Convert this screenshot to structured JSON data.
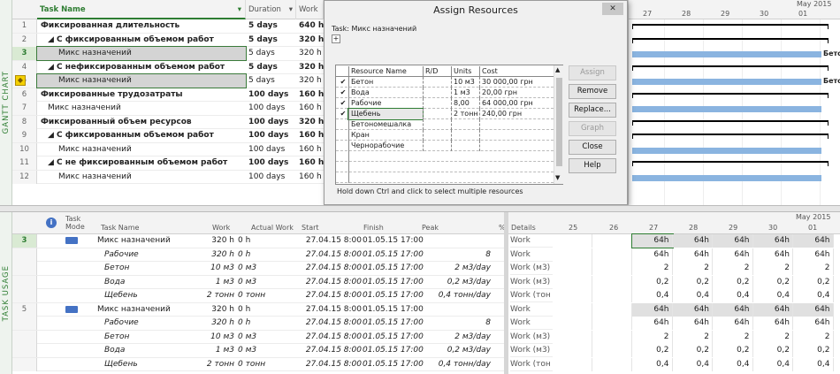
{
  "gantt": {
    "side_label": "GANTT CHART",
    "headers": {
      "task_name": "Task Name",
      "duration": "Duration",
      "work": "Work"
    },
    "rows": [
      {
        "n": "1",
        "name": "Фиксированная длительность",
        "duration": "5 days",
        "work": "640 h",
        "bold": true,
        "indent": 0
      },
      {
        "n": "2",
        "name": "◢ С фиксированным объемом работ",
        "duration": "5 days",
        "work": "320 h",
        "bold": true,
        "indent": 1
      },
      {
        "n": "3",
        "name": "Микс назначений",
        "duration": "5 days",
        "work": "320 h",
        "bold": false,
        "indent": 2
      },
      {
        "n": "4",
        "name": "◢ С нефиксированным объемом работ",
        "duration": "5 days",
        "work": "320 h",
        "bold": true,
        "indent": 1
      },
      {
        "n": "5",
        "name": "Микс назначений",
        "duration": "5 days",
        "work": "320 h",
        "bold": false,
        "indent": 2
      },
      {
        "n": "6",
        "name": "Фиксированные трудозатраты",
        "duration": "100 days",
        "work": "160 h",
        "bold": true,
        "indent": 0
      },
      {
        "n": "7",
        "name": "Микс назначений",
        "duration": "100 days",
        "work": "160 h",
        "bold": false,
        "indent": 1
      },
      {
        "n": "8",
        "name": "Фиксированный объем ресурсов",
        "duration": "100 days",
        "work": "320 h",
        "bold": true,
        "indent": 0
      },
      {
        "n": "9",
        "name": "◢ С фиксированным объемом работ",
        "duration": "100 days",
        "work": "160 h",
        "bold": true,
        "indent": 1
      },
      {
        "n": "10",
        "name": "Микс назначений",
        "duration": "100 days",
        "work": "160 h",
        "bold": false,
        "indent": 2
      },
      {
        "n": "11",
        "name": "◢ С не фиксированным объемом работ",
        "duration": "100 days",
        "work": "160 h",
        "bold": true,
        "indent": 1
      },
      {
        "n": "12",
        "name": "Микс назначений",
        "duration": "100 days",
        "work": "160 h",
        "bold": false,
        "indent": 2
      }
    ],
    "timescale": {
      "month": "May 2015",
      "days": [
        "27",
        "28",
        "29",
        "30",
        "01"
      ]
    },
    "bar_labels": {
      "row3": "Бетон",
      "row5": "Бето"
    }
  },
  "dialog": {
    "title": "Assign Resources",
    "task_label": "Task: Микс назначений",
    "expand": "+",
    "headers": {
      "name": "Resource Name",
      "rd": "R/D",
      "units": "Units",
      "cost": "Cost"
    },
    "resources": [
      {
        "check": "✔",
        "name": "Бетон",
        "units": "10 м3",
        "cost": "30 000,00 грн"
      },
      {
        "check": "✔",
        "name": "Вода",
        "units": "1 м3",
        "cost": "20,00 грн"
      },
      {
        "check": "✔",
        "name": "Рабочие",
        "units": "8,00",
        "cost": "64 000,00 грн"
      },
      {
        "check": "✔",
        "name": "Щебень",
        "units": "2 тонн",
        "cost": "240,00 грн"
      },
      {
        "check": "",
        "name": "Бетономешалка",
        "units": "",
        "cost": ""
      },
      {
        "check": "",
        "name": "Кран",
        "units": "",
        "cost": ""
      },
      {
        "check": "",
        "name": "Чернорабочие",
        "units": "",
        "cost": ""
      }
    ],
    "buttons": {
      "assign": "Assign",
      "remove": "Remove",
      "replace": "Replace...",
      "graph": "Graph",
      "close": "Close",
      "help": "Help"
    },
    "hint": "Hold down Ctrl and click to select multiple resources",
    "close_x": "✕"
  },
  "usage": {
    "side_label": "TASK USAGE",
    "headers": {
      "info": "i",
      "mode": "Task Mode",
      "task_name": "Task Name",
      "work": "Work",
      "actual_work": "Actual Work",
      "start": "Start",
      "finish": "Finish",
      "peak": "Peak",
      "pct": "%"
    },
    "rows": [
      {
        "n": "3",
        "task": true,
        "name": "Микс назначений",
        "work": "320 h",
        "actual": "0 h",
        "start": "27.04.15 8:00",
        "finish": "01.05.15 17:00",
        "peak": ""
      },
      {
        "n": "",
        "task": false,
        "name": "Рабочие",
        "work": "320 h",
        "actual": "0 h",
        "start": "27.04.15 8:00",
        "finish": "01.05.15 17:00",
        "peak": "8"
      },
      {
        "n": "",
        "task": false,
        "name": "Бетон",
        "work": "10 м3",
        "actual": "0 м3",
        "start": "27.04.15 8:00",
        "finish": "01.05.15 17:00",
        "peak": "2 м3/day"
      },
      {
        "n": "",
        "task": false,
        "name": "Вода",
        "work": "1 м3",
        "actual": "0 м3",
        "start": "27.04.15 8:00",
        "finish": "01.05.15 17:00",
        "peak": "0,2 м3/day"
      },
      {
        "n": "",
        "task": false,
        "name": "Щебень",
        "work": "2 тонн",
        "actual": "0 тонн",
        "start": "27.04.15 8:00",
        "finish": "01.05.15 17:00",
        "peak": "0,4 тонн/day"
      },
      {
        "n": "5",
        "task": true,
        "name": "Микс назначений",
        "work": "320 h",
        "actual": "0 h",
        "start": "27.04.15 8:00",
        "finish": "01.05.15 17:00",
        "peak": ""
      },
      {
        "n": "",
        "task": false,
        "name": "Рабочие",
        "work": "320 h",
        "actual": "0 h",
        "start": "27.04.15 8:00",
        "finish": "01.05.15 17:00",
        "peak": "8"
      },
      {
        "n": "",
        "task": false,
        "name": "Бетон",
        "work": "10 м3",
        "actual": "0 м3",
        "start": "27.04.15 8:00",
        "finish": "01.05.15 17:00",
        "peak": "2 м3/day"
      },
      {
        "n": "",
        "task": false,
        "name": "Вода",
        "work": "1 м3",
        "actual": "0 м3",
        "start": "27.04.15 8:00",
        "finish": "01.05.15 17:00",
        "peak": "0,2 м3/day"
      },
      {
        "n": "",
        "task": false,
        "name": "Щебень",
        "work": "2 тонн",
        "actual": "0 тонн",
        "start": "27.04.15 8:00",
        "finish": "01.05.15 17:00",
        "peak": "0,4 тонн/day"
      }
    ],
    "timescale": {
      "details": "Details",
      "month": "May 2015",
      "days": [
        "25",
        "26",
        "27",
        "28",
        "29",
        "30",
        "01"
      ]
    },
    "details": [
      {
        "label": "Work",
        "vals": [
          "64h",
          "64h",
          "64h",
          "64h",
          "64h"
        ]
      },
      {
        "label": "Work",
        "vals": [
          "64h",
          "64h",
          "64h",
          "64h",
          "64h"
        ]
      },
      {
        "label": "Work (м3)",
        "vals": [
          "2",
          "2",
          "2",
          "2",
          "2"
        ]
      },
      {
        "label": "Work (м3)",
        "vals": [
          "0,2",
          "0,2",
          "0,2",
          "0,2",
          "0,2"
        ]
      },
      {
        "label": "Work (тон",
        "vals": [
          "0,4",
          "0,4",
          "0,4",
          "0,4",
          "0,4"
        ]
      },
      {
        "label": "Work",
        "vals": [
          "64h",
          "64h",
          "64h",
          "64h",
          "64h"
        ]
      },
      {
        "label": "Work",
        "vals": [
          "64h",
          "64h",
          "64h",
          "64h",
          "64h"
        ]
      },
      {
        "label": "Work (м3)",
        "vals": [
          "2",
          "2",
          "2",
          "2",
          "2"
        ]
      },
      {
        "label": "Work (м3)",
        "vals": [
          "0,2",
          "0,2",
          "0,2",
          "0,2",
          "0,2"
        ]
      },
      {
        "label": "Work (тон",
        "vals": [
          "0,4",
          "0,4",
          "0,4",
          "0,4",
          "0,4"
        ]
      }
    ]
  },
  "colors": {
    "accent": "#2e7d32",
    "bar_blue": "#8ab4e0"
  }
}
